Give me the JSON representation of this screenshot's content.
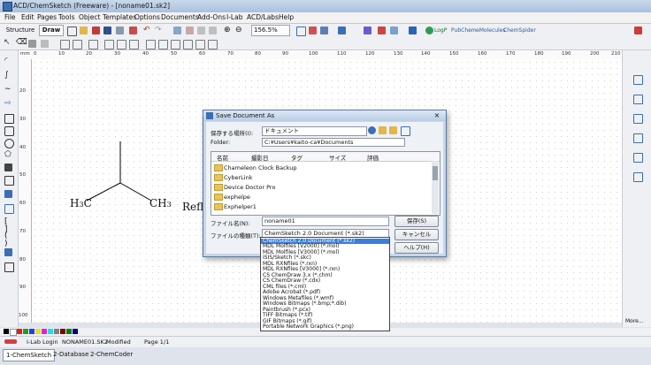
{
  "window": {
    "title": "ACD/ChemSketch (Freeware) - [noname01.sk2]"
  },
  "menu": [
    "File",
    "Edit",
    "Pages",
    "Tools",
    "Object",
    "Templates",
    "Options",
    "Documents",
    "Add-Ons",
    "I-Lab",
    "ACD/Labs",
    "Help"
  ],
  "toolbar": {
    "structure_label": "Structure",
    "draw_label": "Draw",
    "zoom_value": "156.5%",
    "logp_label": "LogP",
    "pubchem_label": "PubChem",
    "emolecules_label": "eMolecules",
    "chemspider_label": "ChemSpider"
  },
  "rulers": {
    "top": [
      "mm",
      "0",
      "10",
      "20",
      "30",
      "40",
      "50",
      "60",
      "70",
      "80",
      "90",
      "100",
      "110",
      "120",
      "130",
      "140",
      "150",
      "160",
      "170",
      "180",
      "190",
      "200",
      "210"
    ],
    "left": [
      "20",
      "30",
      "40",
      "50",
      "60",
      "70",
      "80",
      "90",
      "100"
    ]
  },
  "molecule": {
    "ch3_left": "H",
    "ch3_left_sub": "3",
    "ch3_left_c": "C",
    "ch3_right": "CH",
    "ch3_right_sub": "3",
    "partial_text": "Refl"
  },
  "dialog": {
    "title": "Save Document As",
    "location_label": "保存する場所(I):",
    "location_value": "ドキュメント",
    "folder_label": "Folder:",
    "folder_value": "C:¥Users¥kaito-ca¥Documents",
    "columns": [
      "名前",
      "撮影日",
      "タグ",
      "サイズ",
      "評価"
    ],
    "files": [
      "Chameleon Clock Backup",
      "CyberLink",
      "Device Doctor Pro",
      "exphelpe",
      "Exphelper1"
    ],
    "filename_label": "ファイル名(N):",
    "filename_value": "noname01",
    "filetype_label": "ファイルの種類(T):",
    "filetype_value": "ChemSketch 2.0 Document (*.sk2)",
    "save_button": "保存(S)",
    "cancel_button": "キャンセル",
    "help_button": "ヘルプ(H)"
  },
  "filetype_options": [
    "ChemSketch 2.0 Document (*.sk2)",
    "MDL Molfiles [V2000] (*.mol)",
    "MDL Molfiles [V3000] (*.mol)",
    "ISIS/Sketch (*.skc)",
    "MDL RXNfiles (*.rxn)",
    "MDL RXNfiles [V3000] (*.rxn)",
    "CS ChemDraw 3.x (*.chm)",
    "CS ChemDraw (*.cdx)",
    "CML files (*.cml)",
    "Adobe Acrobat (*.pdf)",
    "Windows Metafiles (*.wmf)",
    "Windows Bitmaps (*.bmp;*.dib)",
    "Paintbrush (*.pcx)",
    "TIFF Bitmaps (*.tif)",
    "GIF Bitmaps (*.gif)",
    "Portable Network Graphics (*.png)"
  ],
  "status": {
    "ilab_login": "I-Lab Login",
    "doc_name": "NONAME01.SK2",
    "modified": "Modified",
    "page": "Page 1/1",
    "more": "More..."
  },
  "tabs": [
    "1-ChemSketch",
    "2-Database",
    "2-ChemCoder"
  ],
  "colors": {
    "accent": "#3b7fd6",
    "title_bar": "#b9cde6",
    "folder": "#e8c45a"
  }
}
